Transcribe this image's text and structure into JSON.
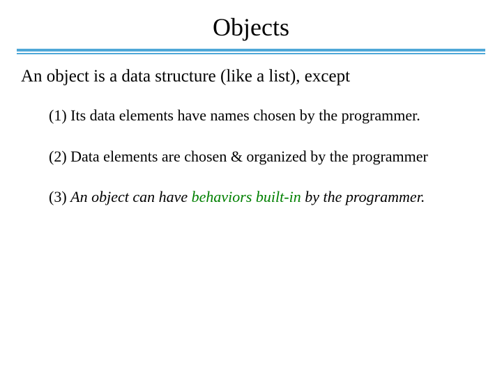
{
  "title": "Objects",
  "intro": "An object is a data structure (like a list), except",
  "point1": "(1) Its data elements have names chosen by the programmer.",
  "point2": "(2) Data elements are chosen & organized by the programmer",
  "point3_prefix": "(3) ",
  "point3_a": "An object can have ",
  "point3_b": "behaviors built-in",
  "point3_c": " by the programmer."
}
